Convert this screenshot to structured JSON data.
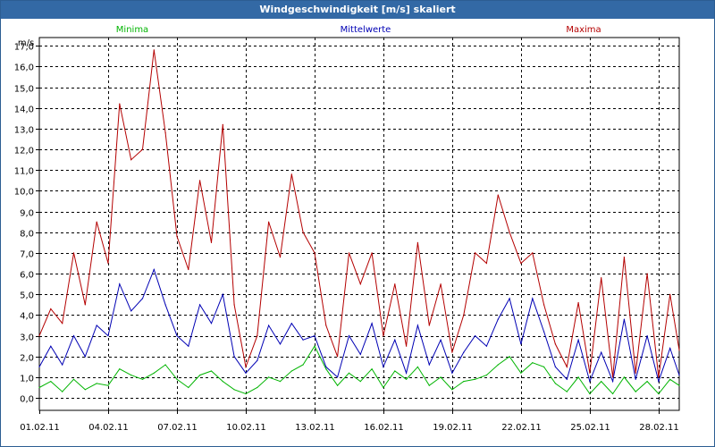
{
  "window": {
    "title": "Windgeschwindigkeit [m/s] skaliert"
  },
  "chart_data": {
    "type": "line",
    "title": "Windgeschwindigkeit [m/s] skaliert",
    "ylabel": "m/s",
    "xlabel": "",
    "ylim": [
      -0.6,
      17.4
    ],
    "yticks": [
      "0,0",
      "1,0",
      "2,0",
      "3,0",
      "4,0",
      "5,0",
      "6,0",
      "7,0",
      "8,0",
      "9,0",
      "10,0",
      "11,0",
      "12,0",
      "13,0",
      "14,0",
      "15,0",
      "16,0",
      "17,0"
    ],
    "xticks": [
      "01.02.11",
      "04.02.11",
      "07.02.11",
      "10.02.11",
      "13.02.11",
      "16.02.11",
      "19.02.11",
      "22.02.11",
      "25.02.11",
      "28.02.11"
    ],
    "xrange_days": [
      1,
      28.9
    ],
    "grid": true,
    "legend_placement": "top",
    "series": [
      {
        "name": "Minima",
        "color": "#00b400",
        "x": [
          1.0,
          1.5,
          2.0,
          2.5,
          3.0,
          3.5,
          4.0,
          4.5,
          5.0,
          5.5,
          6.0,
          6.5,
          7.0,
          7.5,
          8.0,
          8.5,
          9.0,
          9.5,
          10.0,
          10.5,
          11.0,
          11.5,
          12.0,
          12.5,
          13.0,
          13.5,
          14.0,
          14.5,
          15.0,
          15.5,
          16.0,
          16.5,
          17.0,
          17.5,
          18.0,
          18.5,
          19.0,
          19.5,
          20.0,
          20.5,
          21.0,
          21.5,
          22.0,
          22.5,
          23.0,
          23.5,
          24.0,
          24.5,
          25.0,
          25.5,
          26.0,
          26.5,
          27.0,
          27.5,
          28.0,
          28.5,
          28.9
        ],
        "values": [
          0.5,
          0.8,
          0.3,
          0.9,
          0.4,
          0.7,
          0.6,
          1.4,
          1.1,
          0.9,
          1.2,
          1.6,
          0.9,
          0.5,
          1.1,
          1.3,
          0.8,
          0.4,
          0.2,
          0.5,
          1.0,
          0.8,
          1.3,
          1.6,
          2.5,
          1.4,
          0.6,
          1.2,
          0.8,
          1.4,
          0.5,
          1.3,
          0.9,
          1.5,
          0.6,
          1.0,
          0.4,
          0.8,
          0.9,
          1.1,
          1.6,
          2.0,
          1.2,
          1.7,
          1.5,
          0.7,
          0.3,
          1.0,
          0.2,
          0.8,
          0.2,
          1.0,
          0.3,
          0.8,
          0.2,
          0.9,
          0.6
        ]
      },
      {
        "name": "Mittelwerte",
        "color": "#0000b4",
        "x": [
          1.0,
          1.5,
          2.0,
          2.5,
          3.0,
          3.5,
          4.0,
          4.5,
          5.0,
          5.5,
          6.0,
          6.5,
          7.0,
          7.5,
          8.0,
          8.5,
          9.0,
          9.5,
          10.0,
          10.5,
          11.0,
          11.5,
          12.0,
          12.5,
          13.0,
          13.5,
          14.0,
          14.5,
          15.0,
          15.5,
          16.0,
          16.5,
          17.0,
          17.5,
          18.0,
          18.5,
          19.0,
          19.5,
          20.0,
          20.5,
          21.0,
          21.5,
          22.0,
          22.5,
          23.0,
          23.5,
          24.0,
          24.5,
          25.0,
          25.5,
          26.0,
          26.5,
          27.0,
          27.5,
          28.0,
          28.5,
          28.9
        ],
        "values": [
          1.5,
          2.5,
          1.6,
          3.0,
          2.0,
          3.5,
          3.0,
          5.5,
          4.2,
          4.8,
          6.2,
          4.5,
          3.0,
          2.5,
          4.5,
          3.6,
          5.0,
          2.0,
          1.2,
          1.8,
          3.5,
          2.6,
          3.6,
          2.8,
          3.0,
          1.5,
          1.0,
          3.0,
          2.1,
          3.6,
          1.5,
          2.8,
          1.2,
          3.5,
          1.6,
          2.8,
          1.2,
          2.2,
          3.0,
          2.5,
          3.8,
          4.8,
          2.6,
          4.8,
          3.2,
          1.5,
          0.9,
          2.8,
          0.8,
          2.2,
          0.8,
          3.8,
          0.9,
          3.0,
          0.8,
          2.4,
          1.1
        ]
      },
      {
        "name": "Maxima",
        "color": "#b40000",
        "x": [
          1.0,
          1.5,
          2.0,
          2.5,
          3.0,
          3.5,
          4.0,
          4.5,
          5.0,
          5.5,
          6.0,
          6.5,
          7.0,
          7.5,
          8.0,
          8.5,
          9.0,
          9.5,
          10.0,
          10.5,
          11.0,
          11.5,
          12.0,
          12.5,
          13.0,
          13.5,
          14.0,
          14.5,
          15.0,
          15.5,
          16.0,
          16.5,
          17.0,
          17.5,
          18.0,
          18.5,
          19.0,
          19.5,
          20.0,
          20.5,
          21.0,
          21.5,
          22.0,
          22.5,
          23.0,
          23.5,
          24.0,
          24.5,
          25.0,
          25.5,
          26.0,
          26.5,
          27.0,
          27.5,
          28.0,
          28.5,
          28.9
        ],
        "values": [
          3.0,
          4.3,
          3.6,
          7.0,
          4.5,
          8.5,
          6.5,
          14.2,
          11.5,
          12.0,
          16.8,
          12.8,
          7.8,
          6.2,
          10.5,
          7.5,
          13.2,
          4.5,
          1.5,
          3.0,
          8.5,
          6.8,
          10.8,
          8.0,
          7.0,
          3.5,
          2.0,
          7.0,
          5.5,
          7.0,
          3.0,
          5.5,
          2.5,
          7.5,
          3.5,
          5.5,
          2.2,
          4.0,
          7.0,
          6.5,
          9.8,
          8.0,
          6.5,
          7.0,
          4.5,
          2.6,
          1.5,
          4.6,
          1.2,
          5.8,
          1.0,
          6.8,
          1.2,
          6.0,
          1.0,
          5.0,
          2.3
        ]
      }
    ]
  }
}
